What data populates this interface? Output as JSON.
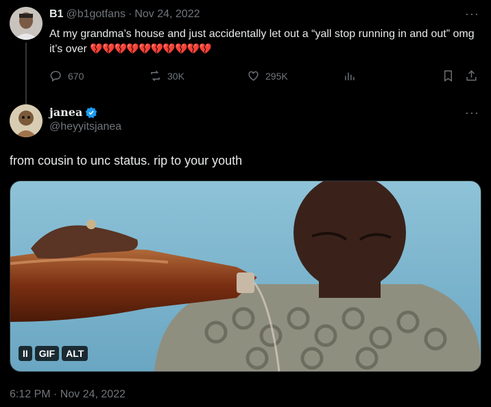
{
  "parent": {
    "display_name": "B1",
    "handle": "@b1gotfans",
    "separator": "·",
    "date": "Nov 24, 2022",
    "text": "At my grandma’s house and just accidentally let out a “yall stop running in and out” omg it’s over",
    "emoji": "💔💔💔💔💔💔💔💔💔💔",
    "more": "···",
    "stats": {
      "replies": "670",
      "reposts": "30K",
      "likes": "295K"
    }
  },
  "reply": {
    "display_name": "janea",
    "handle": "@heyyitsjanea",
    "more": "···",
    "text": "from cousin to unc status. rip to your youth",
    "media": {
      "pause_label": "II",
      "gif_label": "GIF",
      "alt_label": "ALT"
    },
    "timestamp": "6:12 PM · Nov 24, 2022"
  },
  "colors": {
    "verified": "#1d9bf0",
    "heart": "#e0245e",
    "muted": "#71767b"
  }
}
